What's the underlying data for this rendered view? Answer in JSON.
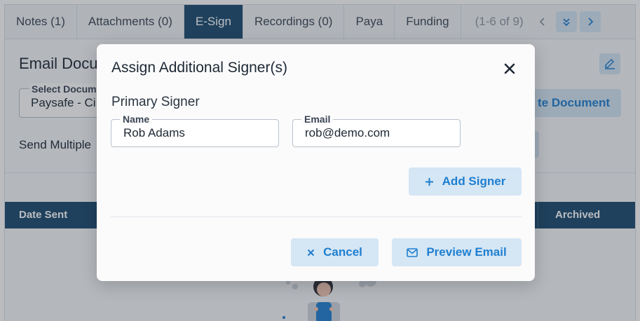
{
  "tabs": [
    {
      "label": "Notes (1)",
      "active": false
    },
    {
      "label": "Attachments (0)",
      "active": false
    },
    {
      "label": "E-Sign",
      "active": true
    },
    {
      "label": "Recordings (0)",
      "active": false
    },
    {
      "label": "Paya",
      "active": false
    },
    {
      "label": "Funding",
      "active": false
    }
  ],
  "pagination": {
    "text": "(1-6 of 9)"
  },
  "background": {
    "title": "Email Docu",
    "select_label": "Select Docum",
    "select_value": "Paysafe - Ci",
    "create_button": "te Document",
    "send_multiple": "Send Multiple",
    "table_headers": {
      "date_sent": "Date Sent",
      "archived": "Archived"
    }
  },
  "modal": {
    "title": "Assign Additional Signer(s)",
    "section_label": "Primary Signer",
    "name_field": {
      "label": "Name",
      "value": "Rob Adams"
    },
    "email_field": {
      "label": "Email",
      "value": "rob@demo.com"
    },
    "add_signer_label": "Add Signer",
    "cancel_label": "Cancel",
    "preview_label": "Preview Email"
  },
  "colors": {
    "accent": "#1f7fd0",
    "tab_active": "#1b4b6e",
    "button_bg": "#d5e6f4"
  }
}
